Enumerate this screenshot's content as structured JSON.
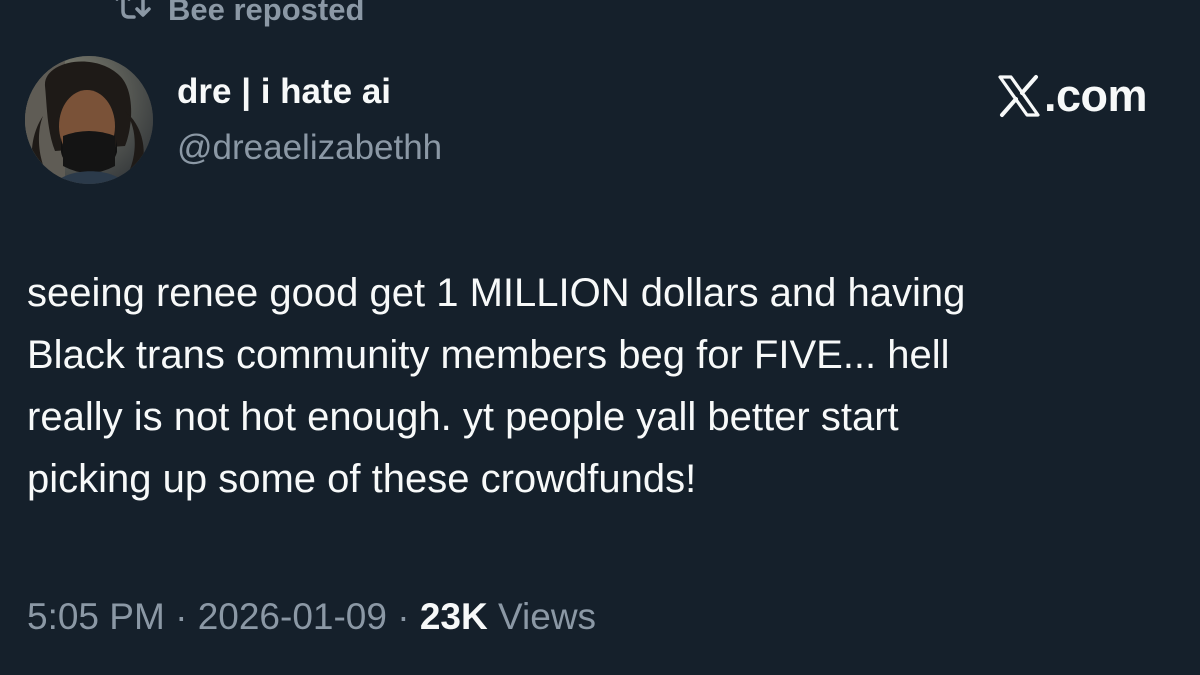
{
  "repost": {
    "icon": "repost-icon",
    "label": "Bee reposted"
  },
  "author": {
    "avatar_icon": "avatar-photo",
    "display_name": "dre | i hate ai",
    "handle": "@dreaelizabethh"
  },
  "brand": {
    "icon": "x-logo-icon",
    "label": ".com"
  },
  "post": {
    "lines": [
      "seeing renee good get 1 MILLION dollars and having",
      "Black trans community members beg for FIVE... hell",
      "really is not hot enough. yt people yall better start",
      "picking up some of these crowdfunds!"
    ]
  },
  "meta": {
    "time": "5:05 PM",
    "separator": " · ",
    "date": "2026-01-09",
    "views_count": "23K",
    "views_label": " Views"
  },
  "colors": {
    "background": "#15202b",
    "primary_text": "#f7f9f9",
    "secondary_text": "#8b98a5"
  }
}
